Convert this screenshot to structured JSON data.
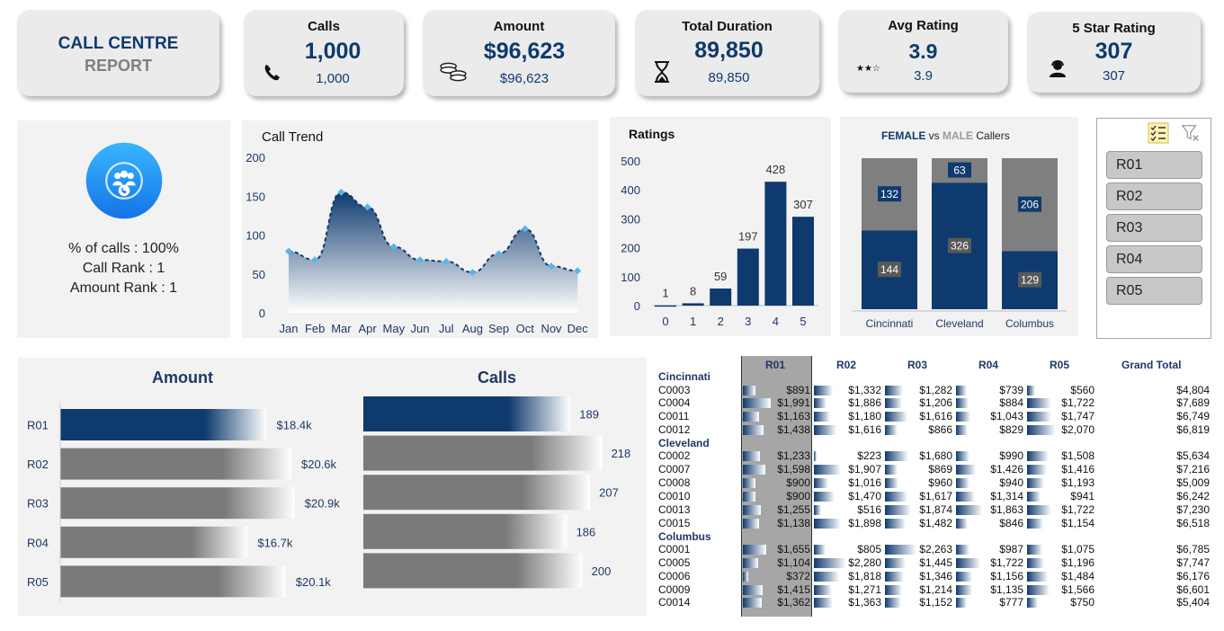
{
  "header": {
    "title_line1": "CALL CENTRE",
    "title_line2": "REPORT"
  },
  "kpis": [
    {
      "title": "Calls",
      "value": "1,000",
      "sub": "1,000",
      "icon": "phone-icon"
    },
    {
      "title": "Amount",
      "value": "$96,623",
      "sub": "$96,623",
      "icon": "coins-icon"
    },
    {
      "title": "Total Duration",
      "value": "89,850",
      "sub": "89,850",
      "icon": "hourglass-icon"
    },
    {
      "title": "Avg Rating",
      "value": "3.9",
      "sub": "3.9",
      "icon": "stars-icon",
      "stars": "★★☆"
    },
    {
      "title": "5 Star Rating",
      "value": "307",
      "sub": "307",
      "icon": "agent-icon"
    }
  ],
  "summary": {
    "line1": "% of calls : 100%",
    "line2": "Call Rank : 1",
    "line3": "Amount Rank : 1",
    "icon": "call-group-icon"
  },
  "colors": {
    "navy": "#0e3a6e",
    "grey": "#7f7f7f",
    "accent": "#1e90ff"
  },
  "chart_data": [
    {
      "type": "area",
      "title": "Call Trend",
      "categories": [
        "Jan",
        "Feb",
        "Mar",
        "Apr",
        "May",
        "Jun",
        "Jul",
        "Aug",
        "Sep",
        "Oct",
        "Nov",
        "Dec"
      ],
      "values": [
        79,
        68,
        155,
        136,
        85,
        68,
        66,
        52,
        76,
        108,
        60,
        54
      ],
      "ylim": [
        0,
        200
      ],
      "yticks": [
        "0",
        "50",
        "100",
        "150",
        "200"
      ]
    },
    {
      "type": "bar",
      "title": "Ratings",
      "categories": [
        "0",
        "1",
        "2",
        "3",
        "4",
        "5"
      ],
      "values": [
        1,
        8,
        59,
        197,
        428,
        307
      ],
      "ylim": [
        0,
        500
      ],
      "yticks": [
        "0",
        "100",
        "200",
        "300",
        "400",
        "500"
      ]
    },
    {
      "type": "bar",
      "title_parts": [
        "FEMALE",
        " vs ",
        "MALE",
        " Callers"
      ],
      "categories": [
        "Cincinnati",
        "Cleveland",
        "Columbus"
      ],
      "series": [
        {
          "name": "MALE",
          "values": [
            144,
            326,
            129
          ]
        },
        {
          "name": "FEMALE",
          "values": [
            132,
            63,
            206
          ]
        }
      ]
    },
    {
      "type": "bar",
      "title": "Amount",
      "categories": [
        "R01",
        "R02",
        "R03",
        "R04",
        "R05"
      ],
      "values": [
        18.4,
        20.6,
        20.9,
        16.7,
        20.1
      ],
      "labels": [
        "$18.4k",
        "$20.6k",
        "$20.9k",
        "$16.7k",
        "$20.1k"
      ]
    },
    {
      "type": "bar",
      "title": "Calls",
      "categories": [
        "R01",
        "R02",
        "R03",
        "R04",
        "R05"
      ],
      "values": [
        189,
        218,
        207,
        186,
        200
      ],
      "labels": [
        "189",
        "218",
        "207",
        "186",
        "200"
      ]
    }
  ],
  "slicer": {
    "items": [
      "R01",
      "R02",
      "R03",
      "R04",
      "R05"
    ],
    "multi_select_icon": "multi-select-icon",
    "clear_filter_icon": "clear-filter-icon"
  },
  "pivot": {
    "headers": [
      "R01",
      "R02",
      "R03",
      "R04",
      "R05",
      "Grand Total"
    ],
    "groups": [
      {
        "city": "Cincinnati",
        "rows": [
          {
            "id": "C0003",
            "vals": [
              891,
              1332,
              1282,
              739,
              560
            ],
            "labels": [
              "$891",
              "$1,332",
              "$1,282",
              "$739",
              "$560"
            ],
            "total": "$4,804"
          },
          {
            "id": "C0004",
            "vals": [
              1991,
              884,
              1206,
              884,
              1722
            ],
            "labels": [
              "$1,991",
              "$1,886",
              "$1,206",
              "$884",
              "$1,722"
            ],
            "total": "$7,689"
          },
          {
            "id": "C0011",
            "vals": [
              1163,
              1180,
              1616,
              1043,
              1747
            ],
            "labels": [
              "$1,163",
              "$1,180",
              "$1,616",
              "$1,043",
              "$1,747"
            ],
            "total": "$6,749"
          },
          {
            "id": "C0012",
            "vals": [
              1438,
              1616,
              866,
              829,
              2070
            ],
            "labels": [
              "$1,438",
              "$1,616",
              "$866",
              "$829",
              "$2,070"
            ],
            "total": "$6,819"
          }
        ]
      },
      {
        "city": "Cleveland",
        "rows": [
          {
            "id": "C0002",
            "vals": [
              1233,
              223,
              1680,
              990,
              1508
            ],
            "labels": [
              "$1,233",
              "$223",
              "$1,680",
              "$990",
              "$1,508"
            ],
            "total": "$5,634"
          },
          {
            "id": "C0007",
            "vals": [
              1598,
              1907,
              869,
              1426,
              1416
            ],
            "labels": [
              "$1,598",
              "$1,907",
              "$869",
              "$1,426",
              "$1,416"
            ],
            "total": "$7,216"
          },
          {
            "id": "C0008",
            "vals": [
              900,
              1016,
              960,
              940,
              1193
            ],
            "labels": [
              "$900",
              "$1,016",
              "$960",
              "$940",
              "$1,193"
            ],
            "total": "$5,009"
          },
          {
            "id": "C0010",
            "vals": [
              900,
              1470,
              1617,
              1314,
              941
            ],
            "labels": [
              "$900",
              "$1,470",
              "$1,617",
              "$1,314",
              "$941"
            ],
            "total": "$6,242"
          },
          {
            "id": "C0013",
            "vals": [
              1255,
              516,
              1874,
              1863,
              1722
            ],
            "labels": [
              "$1,255",
              "$516",
              "$1,874",
              "$1,863",
              "$1,722"
            ],
            "total": "$7,230"
          },
          {
            "id": "C0015",
            "vals": [
              1138,
              1898,
              1482,
              846,
              1154
            ],
            "labels": [
              "$1,138",
              "$1,898",
              "$1,482",
              "$846",
              "$1,154"
            ],
            "total": "$6,518"
          }
        ]
      },
      {
        "city": "Columbus",
        "rows": [
          {
            "id": "C0001",
            "vals": [
              1655,
              805,
              2263,
              987,
              1075
            ],
            "labels": [
              "$1,655",
              "$805",
              "$2,263",
              "$987",
              "$1,075"
            ],
            "total": "$6,785"
          },
          {
            "id": "C0005",
            "vals": [
              1104,
              2280,
              1445,
              1722,
              1196
            ],
            "labels": [
              "$1,104",
              "$2,280",
              "$1,445",
              "$1,722",
              "$1,196"
            ],
            "total": "$7,747"
          },
          {
            "id": "C0006",
            "vals": [
              372,
              1818,
              1346,
              1156,
              1484
            ],
            "labels": [
              "$372",
              "$1,818",
              "$1,346",
              "$1,156",
              "$1,484"
            ],
            "total": "$6,176"
          },
          {
            "id": "C0009",
            "vals": [
              1415,
              1271,
              1214,
              1135,
              1566
            ],
            "labels": [
              "$1,415",
              "$1,271",
              "$1,214",
              "$1,135",
              "$1,566"
            ],
            "total": "$6,601"
          },
          {
            "id": "C0014",
            "vals": [
              1362,
              1363,
              1152,
              777,
              750
            ],
            "labels": [
              "$1,362",
              "$1,363",
              "$1,152",
              "$777",
              "$750"
            ],
            "total": "$5,404"
          }
        ]
      }
    ]
  }
}
